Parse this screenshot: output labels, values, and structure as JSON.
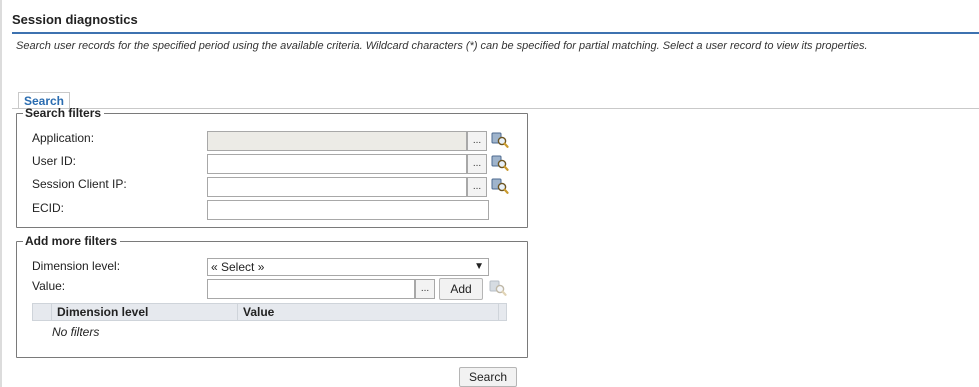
{
  "page": {
    "title": "Session diagnostics",
    "description": "Search user records for the specified period using the available criteria. Wildcard characters (*) can be specified for partial matching. Select a user record to view its properties."
  },
  "tabs": [
    {
      "label": "Search",
      "active": true
    }
  ],
  "search_filters": {
    "legend": "Search filters",
    "fields": [
      {
        "label": "Application:",
        "value": "",
        "readonly": true,
        "browse_label": "...",
        "lookup": true
      },
      {
        "label": "User ID:",
        "value": "",
        "readonly": false,
        "browse_label": "...",
        "lookup": true
      },
      {
        "label": "Session Client IP:",
        "value": "",
        "readonly": false,
        "browse_label": "...",
        "lookup": true
      },
      {
        "label": "ECID:",
        "value": "",
        "readonly": false
      }
    ]
  },
  "more_filters": {
    "legend": "Add more filters",
    "dimension_label": "Dimension level:",
    "dimension_selected": "« Select »",
    "value_label": "Value:",
    "value": "",
    "browse_label": "...",
    "add_label": "Add",
    "grid": {
      "columns": [
        "Dimension level",
        "Value"
      ],
      "empty_text": "No filters"
    }
  },
  "actions": {
    "search_label": "Search"
  },
  "colors": {
    "accent": "#3d72b0",
    "tab_text": "#2a6cb0",
    "readonly_bg": "#ecebe6"
  }
}
